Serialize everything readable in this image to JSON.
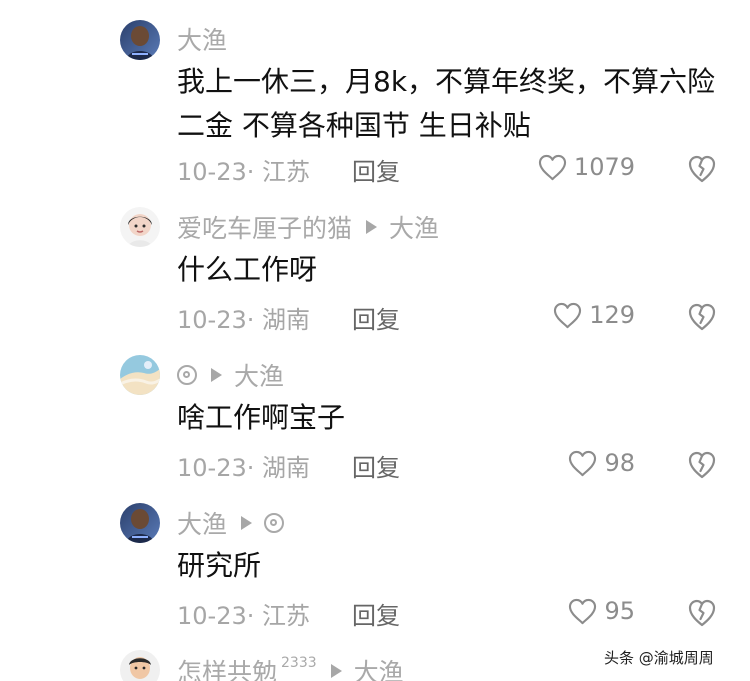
{
  "comments": [
    {
      "author": "大渔",
      "text": "我上一休三，月8k，不算年终奖，不算六险二金 不算各种国节 生日补贴",
      "meta": "10-23· 江苏",
      "reply": "回复",
      "likes": "1079"
    },
    {
      "author": "爱吃车厘子的猫",
      "reply_to": "大渔",
      "text": "什么工作呀",
      "meta": "10-23· 湖南",
      "reply": "回复",
      "likes": "129"
    },
    {
      "author": "◎",
      "reply_to": "大渔",
      "text": "啥工作啊宝子",
      "meta": "10-23· 湖南",
      "reply": "回复",
      "likes": "98"
    },
    {
      "author": "大渔",
      "reply_to": "◎",
      "text": "研究所",
      "meta": "10-23· 江苏",
      "reply": "回复",
      "likes": "95"
    },
    {
      "author": "怎样共勉",
      "author_sup": "2333",
      "reply_to": "大渔"
    }
  ],
  "watermark": "头条 @渝城周周",
  "icons": {
    "like": "heart-outline-icon",
    "dislike": "broken-heart-icon",
    "reply_arrow": "play-arrow-icon"
  },
  "colors": {
    "text": "#111111",
    "muted": "#a9a9a9",
    "reply": "#666666"
  }
}
